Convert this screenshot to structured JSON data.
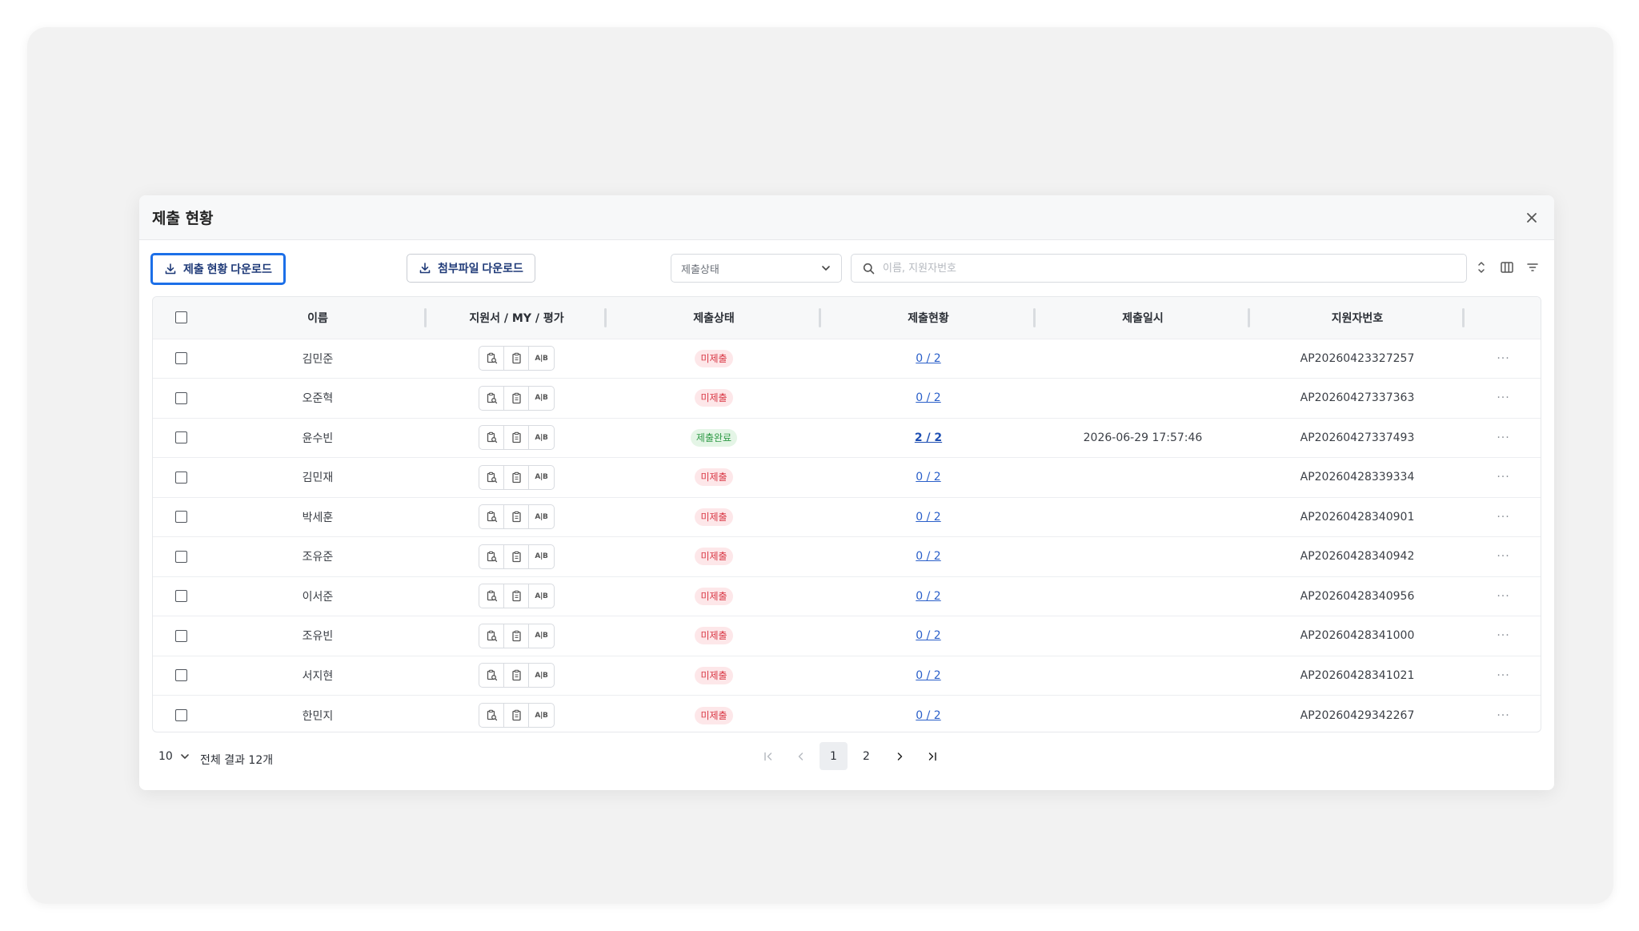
{
  "modal": {
    "title": "제출 현황"
  },
  "toolbar": {
    "download_status_label": "제출 현황 다운로드",
    "download_attachments_label": "첨부파일 다운로드",
    "status_select_value": "제출상태",
    "search_placeholder": "이름, 지원자번호"
  },
  "table": {
    "headers": [
      "이름",
      "지원서 / MY / 평가",
      "제출상태",
      "제출현황",
      "제출일시",
      "지원자번호"
    ],
    "doc_button_label": "A|B",
    "rows": [
      {
        "name": "김민준",
        "status": "미제출",
        "status_kind": "red",
        "progress": "0 / 2",
        "submitted_at": "",
        "applicant_no": "AP20260423327257",
        "more": "···"
      },
      {
        "name": "오준혁",
        "status": "미제출",
        "status_kind": "red",
        "progress": "0 / 2",
        "submitted_at": "",
        "applicant_no": "AP20260427337363",
        "more": "···"
      },
      {
        "name": "윤수빈",
        "status": "제출완료",
        "status_kind": "green",
        "progress": "2 / 2",
        "submitted_at": "2026-06-29 17:57:46",
        "applicant_no": "AP20260427337493",
        "more": "···"
      },
      {
        "name": "김민재",
        "status": "미제출",
        "status_kind": "red",
        "progress": "0 / 2",
        "submitted_at": "",
        "applicant_no": "AP20260428339334",
        "more": "···"
      },
      {
        "name": "박세훈",
        "status": "미제출",
        "status_kind": "red",
        "progress": "0 / 2",
        "submitted_at": "",
        "applicant_no": "AP20260428340901",
        "more": "···"
      },
      {
        "name": "조유준",
        "status": "미제출",
        "status_kind": "red",
        "progress": "0 / 2",
        "submitted_at": "",
        "applicant_no": "AP20260428340942",
        "more": "···"
      },
      {
        "name": "이서준",
        "status": "미제출",
        "status_kind": "red",
        "progress": "0 / 2",
        "submitted_at": "",
        "applicant_no": "AP20260428340956",
        "more": "···"
      },
      {
        "name": "조유빈",
        "status": "미제출",
        "status_kind": "red",
        "progress": "0 / 2",
        "submitted_at": "",
        "applicant_no": "AP20260428341000",
        "more": "···"
      },
      {
        "name": "서지현",
        "status": "미제출",
        "status_kind": "red",
        "progress": "0 / 2",
        "submitted_at": "",
        "applicant_no": "AP20260428341021",
        "more": "···"
      },
      {
        "name": "한민지",
        "status": "미제출",
        "status_kind": "red",
        "progress": "0 / 2",
        "submitted_at": "",
        "applicant_no": "AP20260429342267",
        "more": "···"
      }
    ]
  },
  "footer": {
    "page_size": "10",
    "total_label": "전체 결과 12개",
    "pages": [
      "1",
      "2"
    ],
    "current_page": "1"
  },
  "colors": {
    "primary_border": "#1c6fe8",
    "link": "#2a5fc9",
    "badge_red_bg": "#fde7e9",
    "badge_red_text": "#d93745",
    "badge_green_bg": "#e4f5e6",
    "badge_green_text": "#2f9a46"
  }
}
